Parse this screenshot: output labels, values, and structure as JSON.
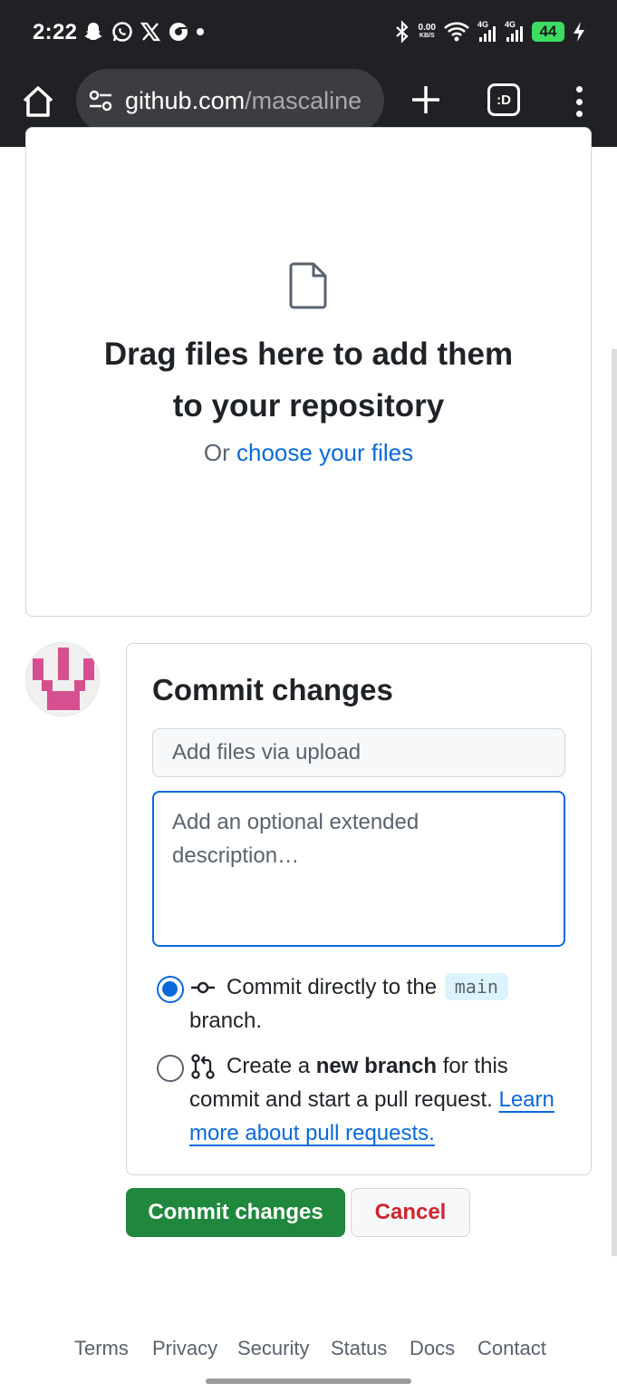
{
  "status_bar": {
    "time": "2:22",
    "left_icons": [
      "snapchat-icon",
      "whatsapp-icon",
      "x-icon",
      "chrome-icon",
      "dot-icon"
    ],
    "data_speed_value": "0.00",
    "data_speed_unit": "KB/S",
    "net_label_1": "4G",
    "net_label_2": "4G",
    "battery": "44"
  },
  "browser": {
    "url_host": "github.com",
    "url_path": "/mascaline",
    "tab_switcher_label": ":D"
  },
  "dropzone": {
    "title_line1": "Drag files here to add them",
    "title_line2": "to your repository",
    "sub_prefix": "Or ",
    "sub_link": "choose your files"
  },
  "commit": {
    "title": "Commit changes",
    "summary_placeholder": "Add files via upload",
    "description_placeholder": "Add an optional extended description…",
    "option_direct": {
      "text_before": "Commit directly to the ",
      "branch": "main",
      "text_after": " branch.",
      "selected": true
    },
    "option_new_branch": {
      "text_before": "Create a ",
      "bold": "new branch",
      "text_after": " for this commit and start a pull request. ",
      "link": "Learn more about pull requests.",
      "selected": false
    },
    "submit_label": "Commit changes",
    "cancel_label": "Cancel"
  },
  "footer": {
    "links": [
      "Terms",
      "Privacy",
      "Security",
      "Status",
      "Docs",
      "Contact"
    ]
  },
  "colors": {
    "primary_green": "#1f883d",
    "link_blue": "#0969da",
    "danger_red": "#d1242f",
    "avatar_pink": "#d6508f"
  }
}
